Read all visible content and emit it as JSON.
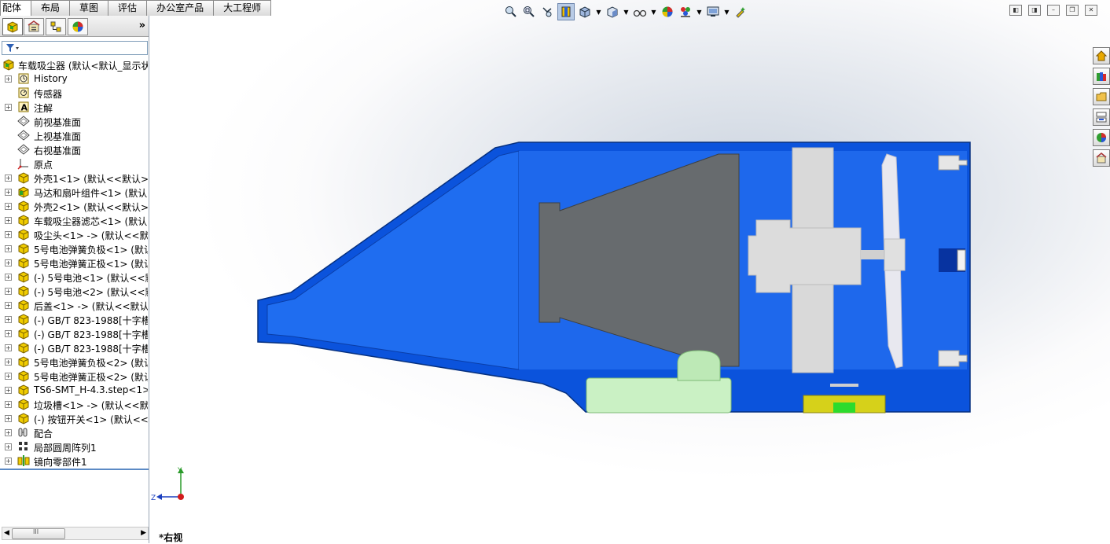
{
  "tabs": [
    {
      "label": "配体",
      "active": true
    },
    {
      "label": "布局",
      "active": false
    },
    {
      "label": "草图",
      "active": false
    },
    {
      "label": "评估",
      "active": false
    },
    {
      "label": "办公室产品",
      "active": false
    },
    {
      "label": "大工程师",
      "active": false
    }
  ],
  "panel": {
    "more_label": "»",
    "root_label": "车载吸尘器  (默认<默认_显示状",
    "items": [
      {
        "label": "History",
        "icon": "history-icon",
        "expand": true
      },
      {
        "label": "传感器",
        "icon": "sensor-icon",
        "expand": false
      },
      {
        "label": "注解",
        "icon": "annotation-icon",
        "expand": true
      },
      {
        "label": "前视基准面",
        "icon": "plane-icon",
        "expand": false
      },
      {
        "label": "上视基准面",
        "icon": "plane-icon",
        "expand": false
      },
      {
        "label": "右视基准面",
        "icon": "plane-icon",
        "expand": false
      },
      {
        "label": "原点",
        "icon": "origin-icon",
        "expand": false
      },
      {
        "label": "外壳1<1> (默认<<默认>_",
        "icon": "part-icon",
        "expand": true
      },
      {
        "label": "马达和扇叶组件<1> (默认<",
        "icon": "subassembly-icon",
        "expand": true
      },
      {
        "label": "外壳2<1> (默认<<默认>_",
        "icon": "part-icon",
        "expand": true
      },
      {
        "label": "车载吸尘器滤芯<1> (默认<",
        "icon": "part-icon",
        "expand": true
      },
      {
        "label": "吸尘头<1> -> (默认<<默认",
        "icon": "part-icon",
        "expand": true
      },
      {
        "label": "5号电池弹簧负极<1> (默认<",
        "icon": "part-icon",
        "expand": true
      },
      {
        "label": "5号电池弹簧正极<1> (默认<",
        "icon": "part-icon",
        "expand": true
      },
      {
        "label": "(-) 5号电池<1> (默认<<默",
        "icon": "part-icon",
        "expand": true
      },
      {
        "label": "(-) 5号电池<2> (默认<<默",
        "icon": "part-icon",
        "expand": true
      },
      {
        "label": "后盖<1> -> (默认<<默认>",
        "icon": "part-icon",
        "expand": true
      },
      {
        "label": "(-) GB/T 823-1988[十字槽",
        "icon": "part-icon",
        "expand": true
      },
      {
        "label": "(-) GB/T 823-1988[十字槽",
        "icon": "part-icon",
        "expand": true
      },
      {
        "label": "(-) GB/T 823-1988[十字槽",
        "icon": "part-icon",
        "expand": true
      },
      {
        "label": "5号电池弹簧负极<2> (默认<",
        "icon": "part-icon",
        "expand": true
      },
      {
        "label": "5号电池弹簧正极<2> (默认<",
        "icon": "part-icon",
        "expand": true
      },
      {
        "label": "TS6-SMT_H-4.3.step<1>",
        "icon": "part-icon",
        "expand": true
      },
      {
        "label": "垃圾槽<1> -> (默认<<默认",
        "icon": "part-icon",
        "expand": true
      },
      {
        "label": "(-) 按钮开关<1> (默认<<默",
        "icon": "part-icon",
        "expand": true
      },
      {
        "label": "配合",
        "icon": "mates-icon",
        "expand": true
      },
      {
        "label": "局部圆周阵列1",
        "icon": "pattern-icon",
        "expand": true
      },
      {
        "label": "镜向零部件1",
        "icon": "mirror-icon",
        "expand": true
      }
    ],
    "scroll_label": "III"
  },
  "viewport": {
    "view_name": "*右视",
    "triad_y": "Y",
    "triad_z": "Z"
  },
  "colors": {
    "shell_blue": "#0a4fd8",
    "part_grey": "#666a6d",
    "part_light": "#d9d9d9",
    "battery_green": "#c9f0c4",
    "switch_yellow": "#d8d21a"
  }
}
